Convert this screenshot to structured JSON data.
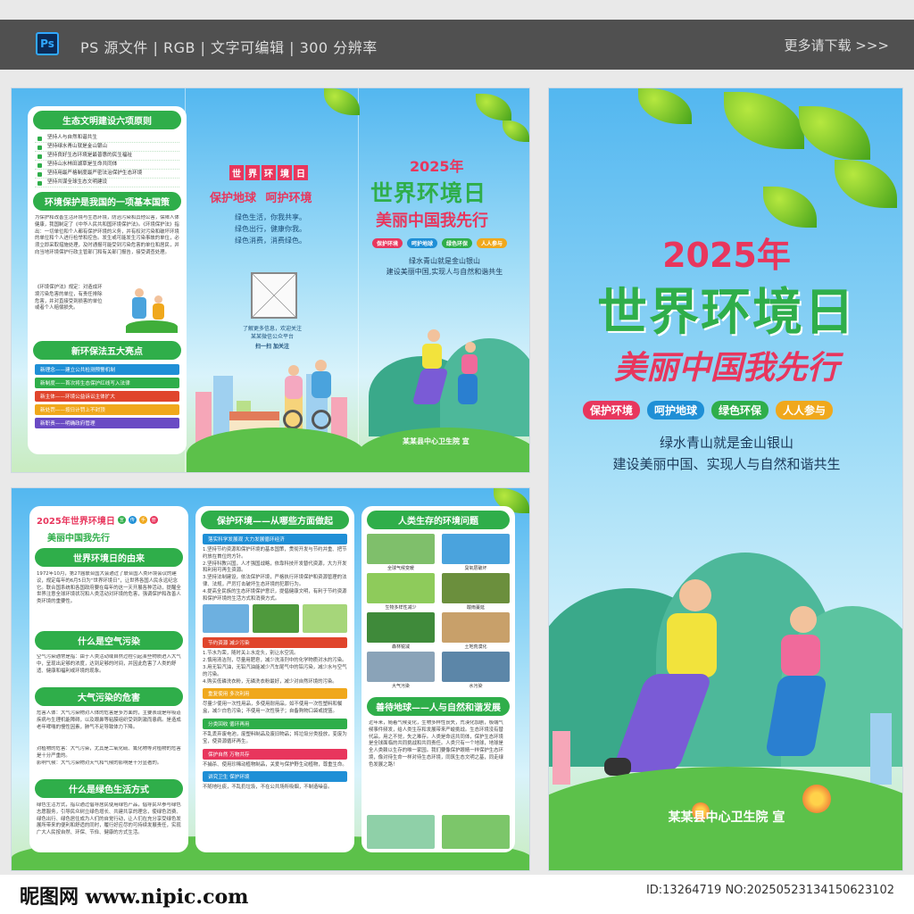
{
  "header": {
    "app_badge": "Ps",
    "meta_text": "PS 源文件 | RGB | 文字可编辑 | 300 分辨率",
    "more_link": "更多请下载 >>>"
  },
  "outer_left": {
    "principles_title": "生态文明建设六项原则",
    "principles": [
      "坚持人与自然和谐共生",
      "坚持绿水青山就是金山银山",
      "坚持良好生态环境是最普惠的民生福祉",
      "坚持山水林田湖草是生命共同体",
      "坚持用最严格制度最严密法治保护生态环境",
      "坚持共谋全球生态文明建设"
    ],
    "policy_title": "环境保护是我国的一项基本国策",
    "policy_text": "为保护和改善生活环境与生态环境，防治污染和其他公害，保障人体健康，我国制定了《中华人民共和国环境保护法》。《环境保护法》指出：一切单位和个人都有保护环境的义务，并有权对污染和破坏环境的单位和个人进行检举和控告。发生或可能发生污染事故的单位，必须立即采取措施处理，及时通报可能受到污染危害的单位和居民，并向当地环境保护行政主管部门和有关部门报告，接受调查处理。",
    "policy_text2": "《环境保护法》规定：对造成环境污染危害的单位，有责任排除危害，并对直接受到损害的单位或者个人赔偿损失。",
    "law_title": "新环保法五大亮点",
    "law_items": [
      "新理念——建立公共检测预警机制",
      "新制度——首次将生态保护红线写入法律",
      "新主体——环境公益诉讼主体扩大",
      "新处罚——按日计罚上不封顶",
      "新职责——明确政府管理"
    ],
    "law_colors": [
      "#1f8fd6",
      "#2fae4a",
      "#e0452c",
      "#f0a81c",
      "#6a4bc4"
    ]
  },
  "outer_middle": {
    "badge_chars": [
      "世",
      "界",
      "环",
      "境",
      "日"
    ],
    "slogan1": "保护地球",
    "slogan2": "呵护环境",
    "lines": [
      "绿色生活，你我共享。",
      "绿色出行，健康你我。",
      "绿色消费，消费绿色。"
    ],
    "qr_caption": "了解更多信息，欢迎关注\n某某微信公众平台",
    "qr_action": "扫一扫 加关注"
  },
  "outer_small_cover": {
    "year": "2025年",
    "title": "世界环境日",
    "subtitle": "美丽中国我先行",
    "tags": [
      "保护环境",
      "呵护地球",
      "绿色环保",
      "人人参与"
    ],
    "line1": "绿水青山就是金山银山",
    "line2": "建设美丽中国,实现人与自然和谐共生",
    "org": "某某县中心卫生院 宣"
  },
  "inner_left": {
    "header_title": "2025年世界环境日",
    "header_tag": [
      "宣",
      "传",
      "手",
      "册"
    ],
    "subheading": "美丽中国我先行",
    "origin_title": "世界环境日的由来",
    "origin_text": "1972年10月，第27届联合国大会通过了联合国人类环境会议的建议，规定每年的6月5日为“世界环境日”，让世界各国人民永远纪念它。联合国系统和各国政府要在每年的这一天开展各种活动，提醒全世界注意全球环境状况和人类活动对环境的危害，强调保护和改善人类环境的重要性。",
    "air_title": "什么是空气污染",
    "air_text": "空气污染通常是指：由于人类活动或自然过程引起某些物质进入大气中，呈现出足够的浓度，达到足够的时间，并因此危害了人类的舒适、健康和福利或环境的现象。",
    "harm_title": "大气污染的危害",
    "harm_text": "危害人体：大气污染物对人体的危害是多方面的，主要表现是呼吸道疾病与生理机能障碍，以及眼鼻等粘膜组织受到刺激而患病。是造成老年哮喘的慢性因素，肺气不足导致体力下降。",
    "harm_text2": "对植物的危害：大气污染，尤其是二氧化硫、氟化物等对植物的危害是十分严重的。",
    "harm_text3": "影响气候：大气污染物对天气和气候的影响是十分显著的。",
    "green_title": "什么是绿色生活方式",
    "green_text": "绿色生活方式，指以通过倡导居民使用绿色产品，倡导民众参与绿色志愿服务，引导民众树立绿色增长、共建共享的理念，使绿色消费、绿色出行、绿色居住成为人们的自觉行动，让人们在充分享受绿色发展所带来的便利和舒适的同时，履行好应尽的可持续发展责任，实现广大人民按自然、环保、节俭、健康的方式生活。"
  },
  "inner_middle": {
    "title": "保护环境——从哪些方面做起",
    "sec1": "落实科学发展观 大力发展循环经济",
    "sec1_items": [
      "1.坚持节约资源和保护环境的基本国策，贯彻开发与节约并重、把节约放在首位的方针。",
      "2.坚持科教兴国，人才强国战略，依靠科技开发替代资源，大力开发和利用可再生资源。",
      "3.坚持法制建设，依法保护环境，严格执行环境保护和资源管理的法律、法规，严厉打击破坏生态环境的犯罪行为。",
      "4.提高全民族的生态环境保护意识，提倡健康文明，有利于节约资源和保护环境的生活方式和消费方式。"
    ],
    "sec2": "节约资源 减少污染",
    "sec2_items": [
      "1.节水为荣，随时关上水龙头，别让水空流。",
      "2.慎用清洁剂，尽量用肥皂，减少洗涤剂中的化学物质对水的污染。",
      "3.用无铅汽油，无铅汽油能减少汽车尾气中的铅污染，减少水与空气的污染。",
      "4.购买低磷洗衣粉，无磷洗衣粉最好，减少对自然环境的污染。"
    ],
    "sec3": "重复使用 多次利用",
    "sec3_text": "尽量少使用一次性用品，多使用耐用品，如不使用一次性塑料和餐盒，减少白色污染；不使用一次性筷子；自备购物口袋或提篮。",
    "sec4": "分类回收 循环再用",
    "sec4_text": "不乱丢弃废电池，废塑料制品及废旧物品；将垃圾分类投放，变废为宝，使资源循环再生。",
    "sec5": "保护自然 万物共存",
    "sec5_text": "不捕杀、使用珍稀动植物制品，关爱与保护野生动植物，尊重生命。",
    "sec6": "讲究卫生 保护环境",
    "sec6_text": "不随地吐痰，不乱扔垃圾，不在公共场所吸烟，不制造噪音。"
  },
  "inner_right": {
    "title": "人类生存的环境问题",
    "photos": [
      "全球气候变暖",
      "臭氧层破坏",
      "生物多样性减少",
      "酸雨蔓延",
      "森林锐减",
      "土地荒漠化",
      "大气污染",
      "水污染"
    ],
    "photo_colors": [
      "#7fbf6b",
      "#4aa3dd",
      "#8ecb5b",
      "#6b8f3d",
      "#3f8a3a",
      "#c8a06a",
      "#8aa3b8",
      "#5c86a8"
    ],
    "harmony_title": "善待地球——人与自然和谐发展",
    "harmony_text": "近年来，随着气候变化，生物多样性丧失，荒漠化加剧，极端气候事件频发，给人类生存和发展带来严峻挑战。生态环境没有替代品，用之不觉，失之难存。人类是命运共同体，保护生态环境是全球面临的共同挑战和共同责任。人类只有一个地球，地球是全人类赖以生存的唯一家园。我们要像保护眼睛一样保护生态环境，像对待生命一样对待生态环境，同筑生态文明之基，同走绿色发展之路！"
  },
  "cover": {
    "year": "2025年",
    "title": "世界环境日",
    "subtitle": "美丽中国我先行",
    "tags": [
      "保护环境",
      "呵护地球",
      "绿色环保",
      "人人参与"
    ],
    "tag_colors": [
      "#e8365d",
      "#1f8fd6",
      "#2fae4a",
      "#f0a81c"
    ],
    "line1": "绿水青山就是金山银山",
    "line2": "建设美丽中国、实现人与自然和谐共生",
    "org": "某某县中心卫生院 宣"
  },
  "footer": {
    "site_logo": "昵图网 www.nipic.com",
    "image_id": "ID:13264719 NO:20250523134150623102"
  }
}
